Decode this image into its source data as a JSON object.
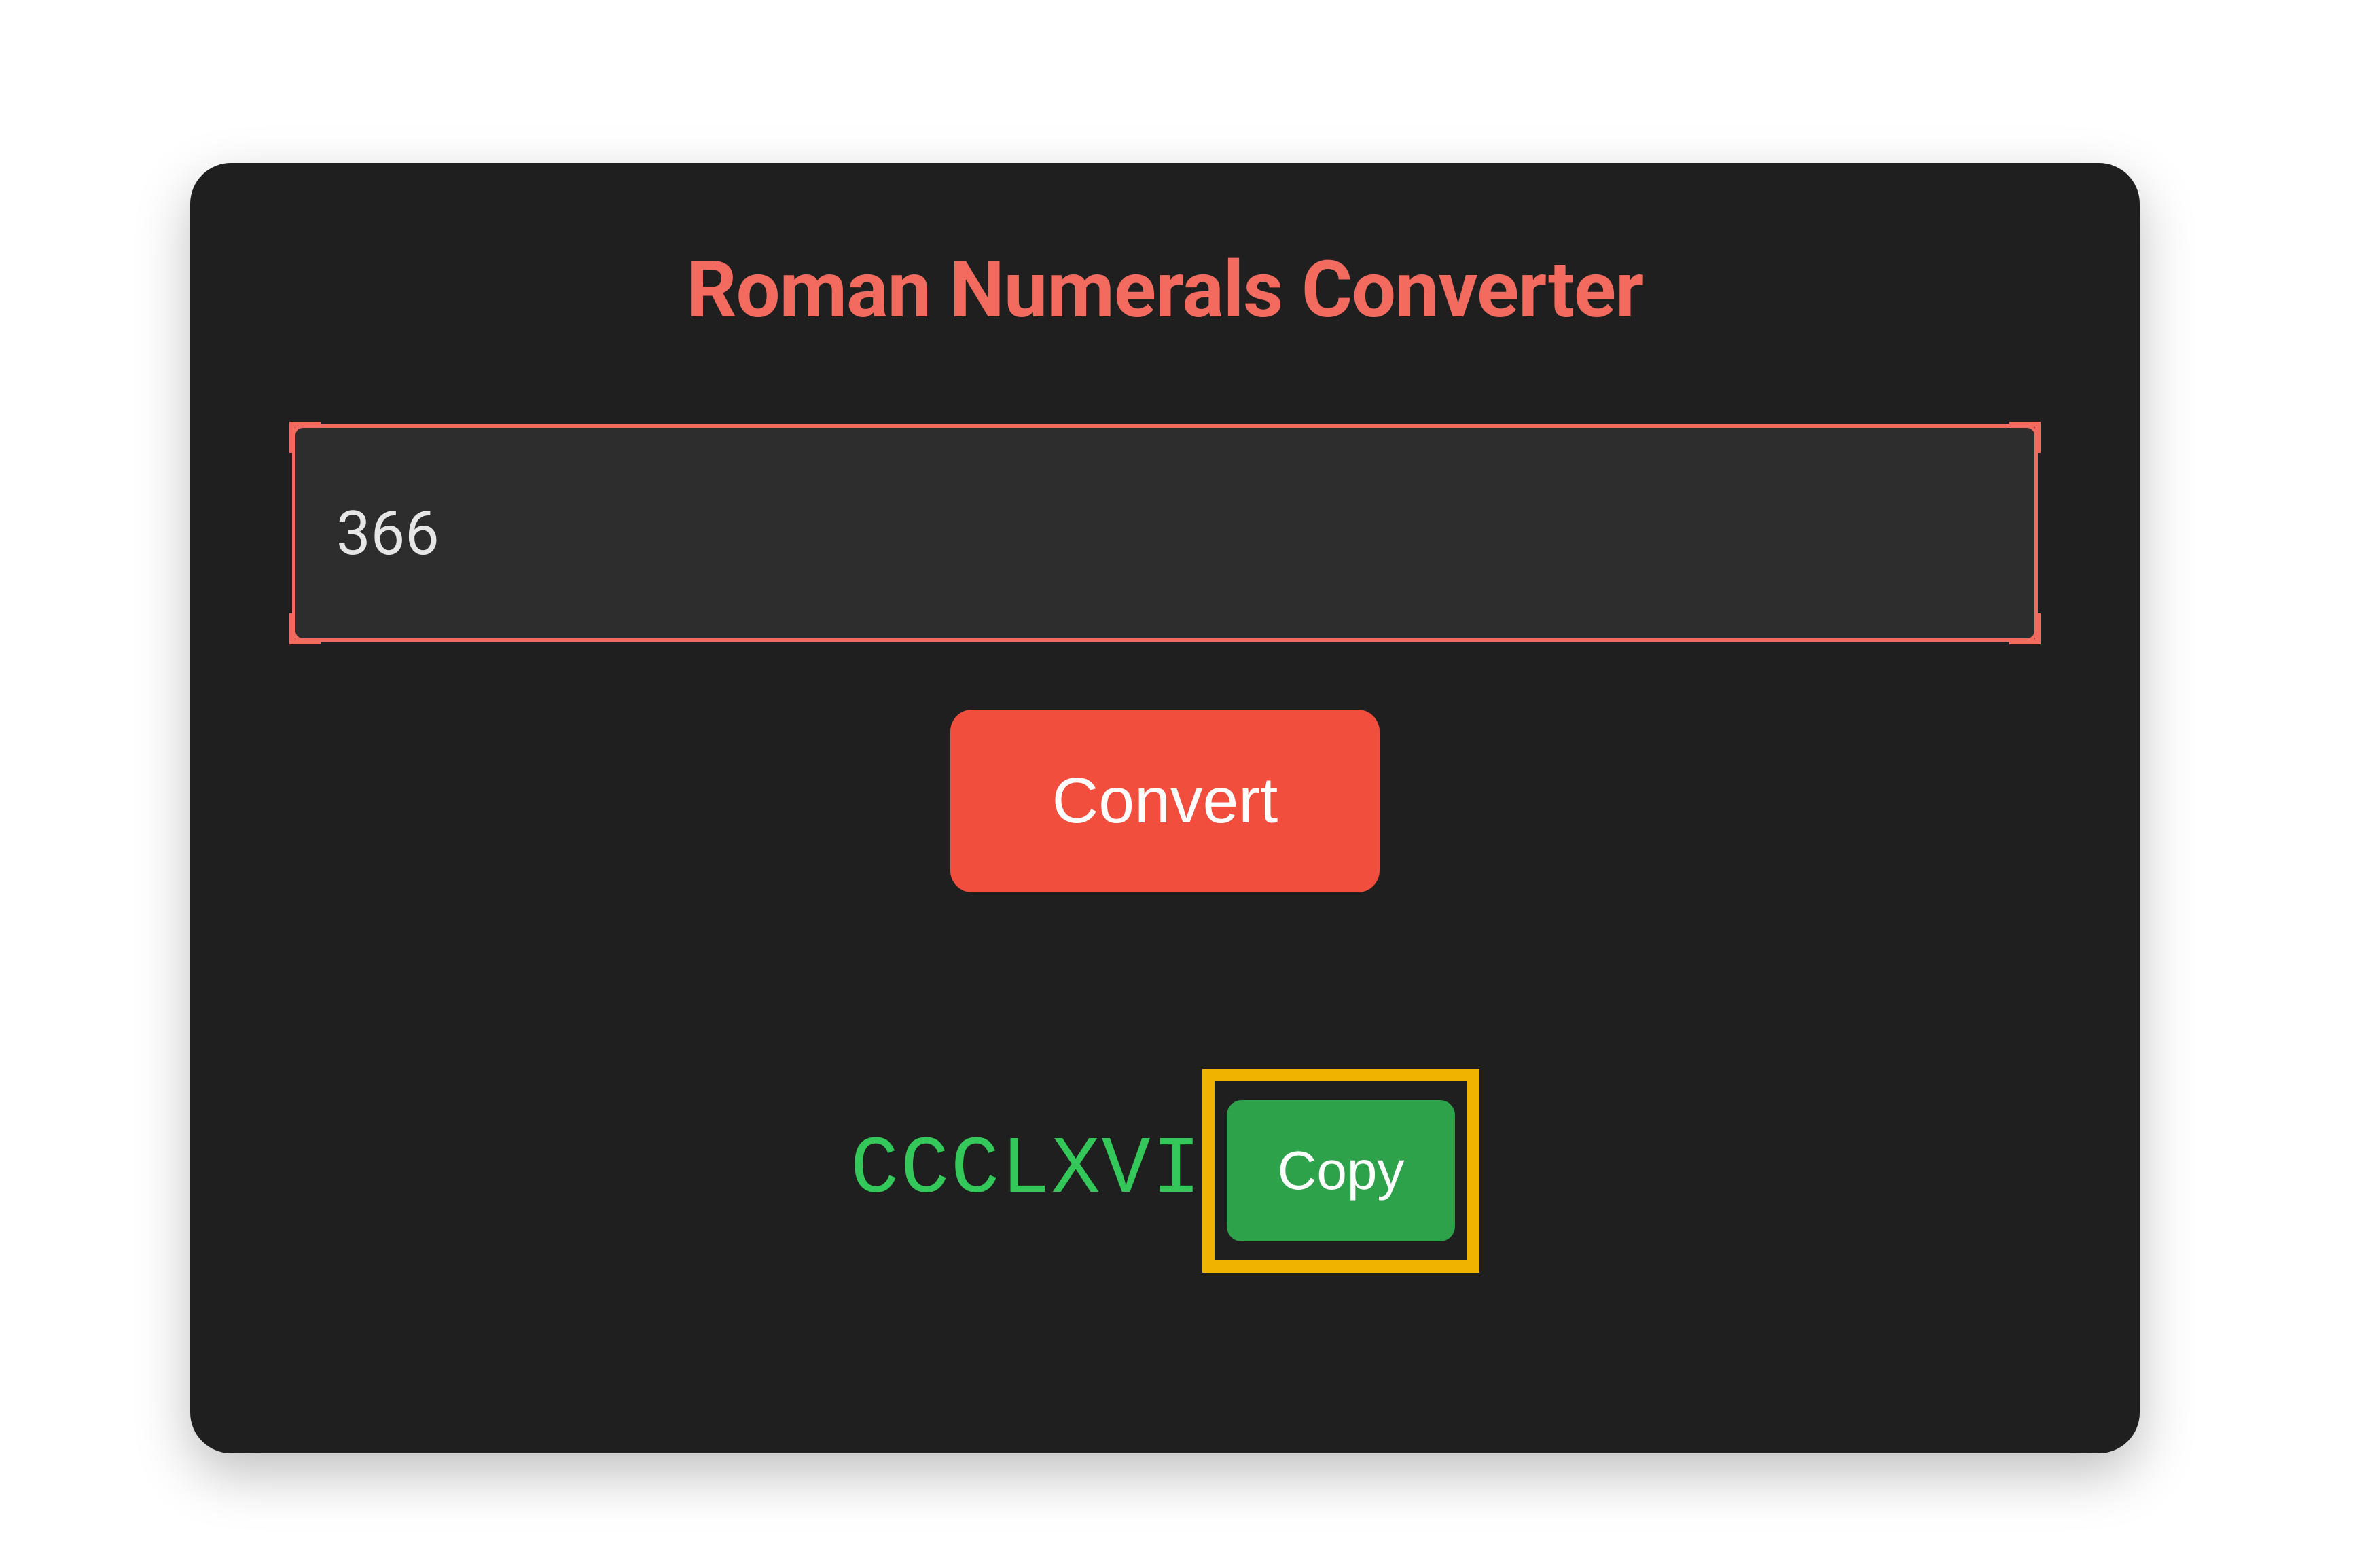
{
  "title": "Roman Numerals Converter",
  "input": {
    "value": "366",
    "placeholder": ""
  },
  "buttons": {
    "convert": "Convert",
    "copy": "Copy"
  },
  "result": "CCCLXVI",
  "colors": {
    "card_bg": "#1f1f1f",
    "accent_red": "#f24e3e",
    "accent_red_soft": "#f26b5e",
    "result_green": "#34c759",
    "copy_green": "#2ea24a",
    "highlight_yellow": "#f0b400",
    "input_bg": "#2d2d2d",
    "text_light": "#e6e6e6"
  }
}
